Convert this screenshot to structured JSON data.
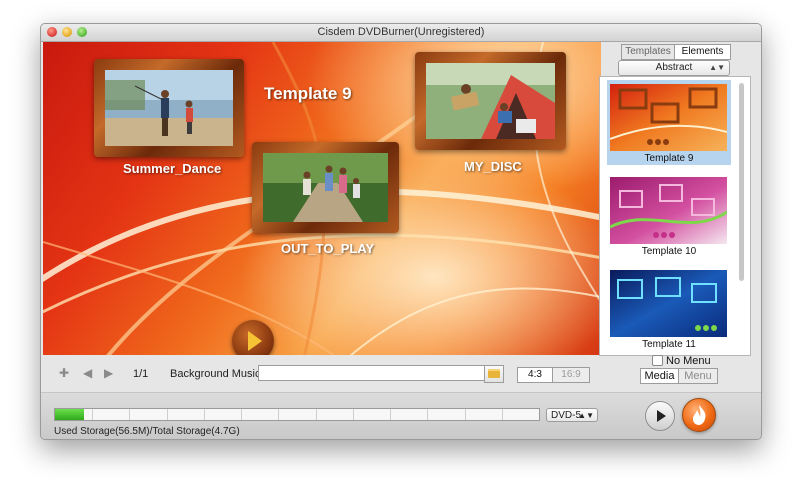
{
  "window": {
    "title": "Cisdem DVDBurner(Unregistered)"
  },
  "preview": {
    "menu_title": "Template 9",
    "items": [
      {
        "label": "Summer_Dance"
      },
      {
        "label": "OUT_TO_PLAY"
      },
      {
        "label": "MY_DISC"
      }
    ]
  },
  "controls": {
    "page_indicator": "1/1",
    "background_music_label": "Background Music:",
    "background_music_value": "",
    "ratio_4_3": "4:3",
    "ratio_16_9": "16:9"
  },
  "panel": {
    "tab_templates": "Templates",
    "tab_elements": "Elements",
    "category": "Abstract",
    "templates": [
      {
        "label": "Template 9",
        "selected": true
      },
      {
        "label": "Template 10",
        "selected": false
      },
      {
        "label": "Template 11",
        "selected": false
      }
    ],
    "no_menu_label": "No Menu",
    "no_menu_checked": false,
    "mode_media": "Media",
    "mode_menu": "Menu"
  },
  "bottom": {
    "storage_text": "Used Storage(56.5M)/Total Storage(4.7G)",
    "storage_used_fraction": 0.012,
    "disc_type": "DVD-5"
  },
  "colors": {
    "accent_selected": "#b7d4ef",
    "storage_fill": "#3ebf23",
    "burn": "#f06a14"
  }
}
